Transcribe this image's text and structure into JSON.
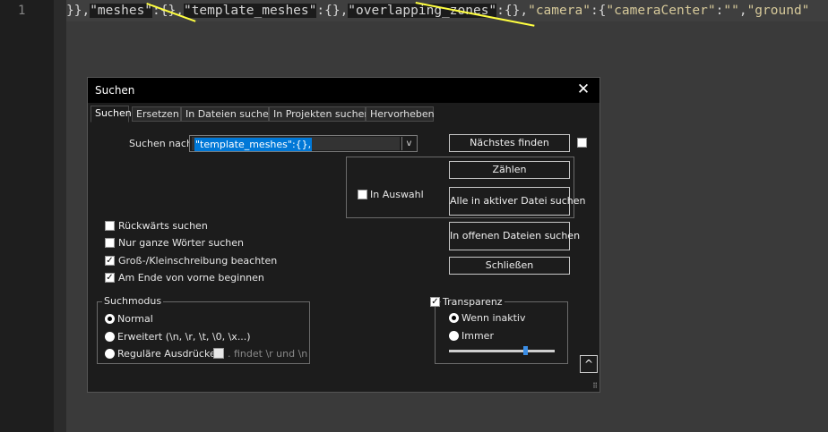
{
  "editor": {
    "line_number": "1",
    "code_segments": [
      {
        "text": "}},",
        "cls": "tk-punct"
      },
      {
        "text": "\"meshes\"",
        "cls": "tk-hl"
      },
      {
        "text": ":{},",
        "cls": "tk-punct"
      },
      {
        "text": "\"template_meshes\"",
        "cls": "tk-hl"
      },
      {
        "text": ":{},",
        "cls": "tk-punct"
      },
      {
        "text": "\"overlapping_zones\"",
        "cls": "tk-hl"
      },
      {
        "text": ":{},",
        "cls": "tk-punct"
      },
      {
        "text": "\"camera\"",
        "cls": "tk-key"
      },
      {
        "text": ":{",
        "cls": "tk-punct"
      },
      {
        "text": "\"cameraCenter\"",
        "cls": "tk-key"
      },
      {
        "text": ":",
        "cls": "tk-punct"
      },
      {
        "text": "\"\"",
        "cls": "tk-key"
      },
      {
        "text": ",",
        "cls": "tk-punct"
      },
      {
        "text": "\"ground\"",
        "cls": "tk-key"
      }
    ],
    "annotation_color": "#ffff40"
  },
  "dialog": {
    "title": "Suchen",
    "close_glyph": "✕",
    "tabs": [
      "Suchen",
      "Ersetzen",
      "In Dateien suchen",
      "In Projekten suchen",
      "Hervorheben"
    ],
    "search_label": "Suchen nach:",
    "search_value": "\"template_meshes\":{},",
    "combo_arrow": "v",
    "buttons": {
      "find_next": "Nächstes finden",
      "count": "Zählen",
      "find_all_current": "Alle in aktiver Datei suchen",
      "find_all_open": "In offenen Dateien suchen",
      "close": "Schließen"
    },
    "in_selection": "In Auswahl",
    "options": {
      "backward": {
        "label": "Rückwärts suchen",
        "checked": false
      },
      "whole_word": {
        "label": "Nur ganze Wörter suchen",
        "checked": false
      },
      "match_case": {
        "label": "Groß-/Kleinschreibung beachten",
        "checked": true
      },
      "wrap": {
        "label": "Am Ende von vorne beginnen",
        "checked": true
      }
    },
    "search_mode": {
      "label": "Suchmodus",
      "normal": "Normal",
      "extended": "Erweitert (\\n, \\r, \\t, \\0, \\x...)",
      "regex": "Reguläre Ausdrücke",
      "dot_newline": ". findet \\r und \\n",
      "selected": "normal"
    },
    "transparency": {
      "label": "Transparenz",
      "checked": true,
      "on_inactive": "Wenn inaktiv",
      "always": "Immer",
      "selected": "on_inactive",
      "level": 0.72
    },
    "check_glyph": "✓",
    "collapse_glyph": "^",
    "grip_glyph": "⠿"
  }
}
